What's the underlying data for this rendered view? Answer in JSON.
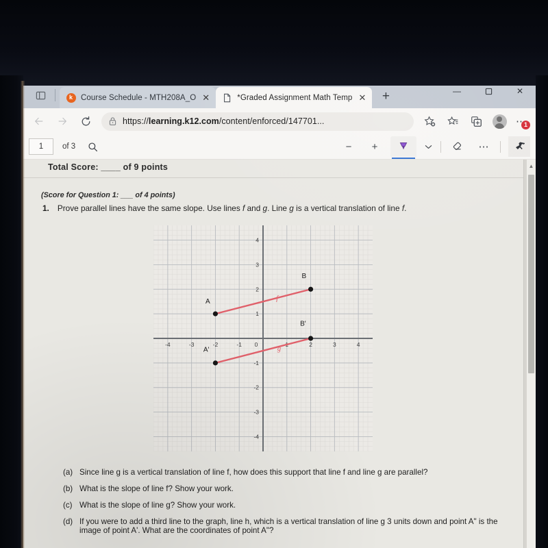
{
  "browser": {
    "tab_overview_icon": "tab-overview-icon",
    "tabs": [
      {
        "title": "Course Schedule - MTH208A_O",
        "favicon": "k12-favicon",
        "active": false,
        "close_label": "✕"
      },
      {
        "title": "*Graded Assignment Math Temp",
        "favicon": "document-favicon",
        "active": true,
        "close_label": "✕"
      }
    ],
    "new_tab_label": "+",
    "window_controls": {
      "minimize": "—",
      "maximize": "☐",
      "close": "✕"
    },
    "nav": {
      "back_icon": "back-arrow-icon",
      "forward_icon": "forward-arrow-icon",
      "refresh_icon": "refresh-icon",
      "lock_icon": "lock-icon",
      "url_scheme": "https://",
      "url_host": "learning.k12.com",
      "url_path": "/content/enforced/147701...",
      "favorite_icon": "star-add-icon",
      "favorites_list_icon": "star-list-icon",
      "collections_icon": "collections-icon",
      "profile_icon": "profile-avatar-icon",
      "settings_icon": "ellipsis-settings-icon",
      "settings_badge": "1"
    }
  },
  "pdf_toolbar": {
    "page_number": "1",
    "page_total": "of 3",
    "search_icon": "search-icon",
    "zoom_out_label": "−",
    "zoom_in_label": "+",
    "highlighter_icon": "highlighter-icon",
    "highlighter_chevron": "chevron-down-icon",
    "eraser_icon": "eraser-icon",
    "more_label": "⋯",
    "pin_icon": "pin-icon"
  },
  "document": {
    "total_score": "Total Score: ____ of 9 points",
    "score_for_question": "(Score for Question 1: ___ of 4 points)",
    "question_number": "1.",
    "question_text_parts": {
      "a": "Prove parallel lines have the same slope. Use lines ",
      "f1": "f",
      "b": " and ",
      "g1": "g",
      "c": ". Line ",
      "g2": "g",
      "d": " is a vertical translation of line ",
      "f2": "f",
      "e": "."
    },
    "subquestions": [
      {
        "label": "(a)",
        "text": "Since line g is a vertical translation of line f, how does this support that line f and line g are parallel?"
      },
      {
        "label": "(b)",
        "text": "What is the slope of line f?  Show your work."
      },
      {
        "label": "(c)",
        "text": "What is the slope of line g?  Show your work."
      },
      {
        "label": "(d)",
        "text": "If you were to add a third line to the graph, line h, which is a vertical translation of line g 3 units down and point A\" is the image of point A'.  What are the coordinates of point A\"?"
      }
    ]
  },
  "chart_data": {
    "type": "scatter",
    "title": "",
    "xlabel": "",
    "ylabel": "",
    "xlim": [
      -4.6,
      4.6
    ],
    "ylim": [
      -4.6,
      4.6
    ],
    "xticks": [
      -4,
      -3,
      -2,
      -1,
      0,
      1,
      2,
      3,
      4
    ],
    "yticks": [
      -4,
      -3,
      -2,
      -1,
      1,
      2,
      3,
      4
    ],
    "xtick_labels": [
      "-4",
      "-3",
      "-2",
      "-1",
      "0",
      "1",
      "2",
      "3",
      "4"
    ],
    "ytick_labels": [
      "-4",
      "-3",
      "-2",
      "-1",
      "1",
      "2",
      "3",
      "4"
    ],
    "grid": true,
    "grid_color": "#b9bcc0",
    "minor_grid": true,
    "axis_color": "#6b6f74",
    "line_color": "#e0606a",
    "point_color": "#161616",
    "series": [
      {
        "name": "f",
        "label": "f",
        "label_pos": [
          0.55,
          1.55
        ],
        "points": [
          {
            "name": "A",
            "x": -2,
            "y": 1,
            "label_offset": [
              -0.32,
              0.42
            ]
          },
          {
            "name": "B",
            "x": 2,
            "y": 2,
            "label_offset": [
              -0.28,
              0.46
            ]
          }
        ]
      },
      {
        "name": "g",
        "label": "g",
        "label_pos": [
          0.6,
          -0.5
        ],
        "points": [
          {
            "name": "A'",
            "x": -2,
            "y": -1,
            "label_offset": [
              -0.38,
              0.45
            ]
          },
          {
            "name": "B'",
            "x": 2,
            "y": 0,
            "label_offset": [
              -0.32,
              0.52
            ]
          }
        ]
      }
    ]
  }
}
